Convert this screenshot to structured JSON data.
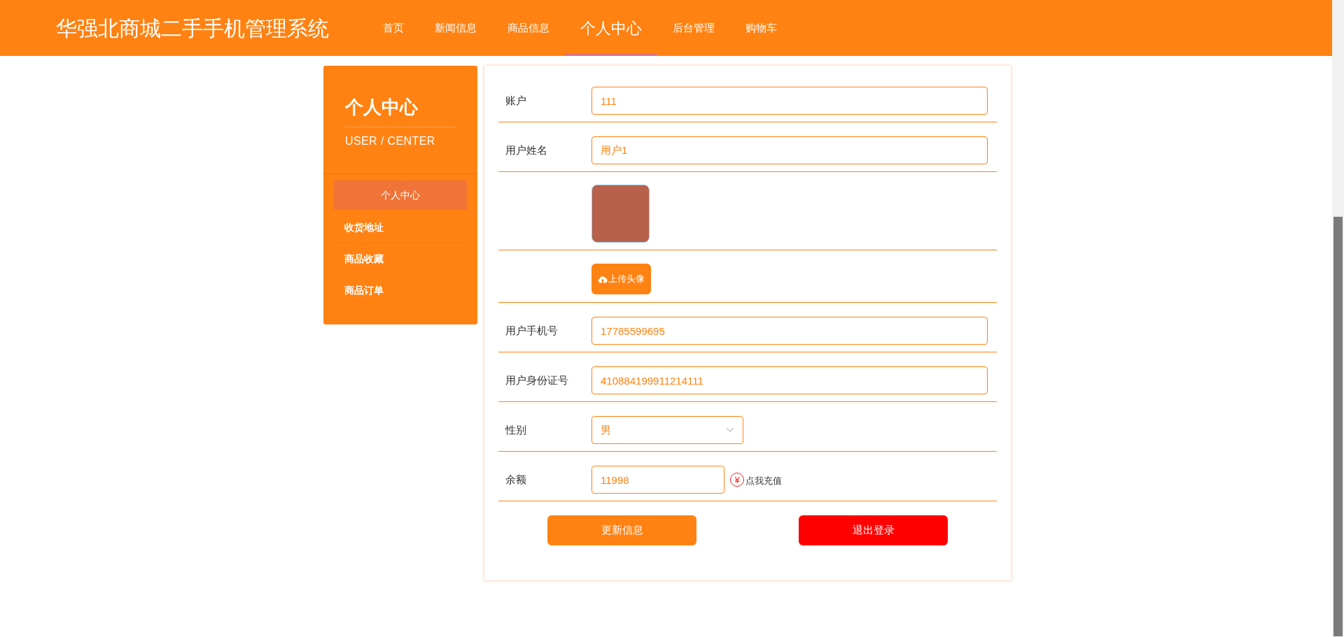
{
  "header": {
    "title": "华强北商城二手手机管理系统",
    "nav": [
      {
        "label": "首页",
        "selected": false
      },
      {
        "label": "新闻信息",
        "selected": false
      },
      {
        "label": "商品信息",
        "selected": false
      },
      {
        "label": "个人中心",
        "selected": true
      },
      {
        "label": "后台管理",
        "selected": false
      },
      {
        "label": "购物车",
        "selected": false
      }
    ]
  },
  "sidebar": {
    "title": "个人中心",
    "subtitle": "USER / CENTER",
    "items": [
      {
        "label": "个人中心",
        "selected": true
      },
      {
        "label": "收货地址",
        "selected": false
      },
      {
        "label": "商品收藏",
        "selected": false
      },
      {
        "label": "商品订单",
        "selected": false
      }
    ]
  },
  "form": {
    "rows": [
      {
        "kind": "text",
        "label": "账户",
        "value": "111"
      },
      {
        "kind": "text",
        "label": "用户姓名",
        "value": "用户1"
      },
      {
        "kind": "avatar"
      },
      {
        "kind": "upload",
        "button": "上传头像"
      },
      {
        "kind": "text",
        "label": "用户手机号",
        "value": "17785599695"
      },
      {
        "kind": "text",
        "label": "用户身份证号",
        "value": "410884199911214111"
      },
      {
        "kind": "select",
        "label": "性别",
        "value": "男"
      },
      {
        "kind": "balance",
        "label": "余额",
        "value": "11998",
        "icon": "¥",
        "link": "点我充值"
      }
    ],
    "buttons": [
      {
        "kind": "primary",
        "label": "更新信息"
      },
      {
        "kind": "danger",
        "label": "退出登录"
      }
    ]
  }
}
